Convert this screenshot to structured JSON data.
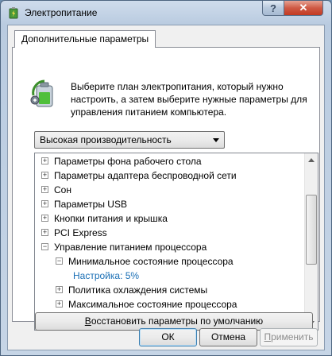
{
  "window": {
    "title": "Электропитание",
    "help_label": "?",
    "close_label": "✕"
  },
  "tab": {
    "label": "Дополнительные параметры"
  },
  "description": "Выберите план электропитания, который нужно настроить, а затем выберите нужные параметры для управления питанием компьютера.",
  "plan_select": {
    "selected": "Высокая производительность"
  },
  "tree": {
    "items": [
      {
        "label": "Параметры фона рабочего стола",
        "expander": "+",
        "level": 0
      },
      {
        "label": "Параметры адаптера беспроводной сети",
        "expander": "+",
        "level": 0
      },
      {
        "label": "Сон",
        "expander": "+",
        "level": 0
      },
      {
        "label": "Параметры USB",
        "expander": "+",
        "level": 0
      },
      {
        "label": "Кнопки питания и крышка",
        "expander": "+",
        "level": 0
      },
      {
        "label": "PCI Express",
        "expander": "+",
        "level": 0
      },
      {
        "label": "Управление питанием процессора",
        "expander": "−",
        "level": 0
      },
      {
        "label": "Минимальное состояние процессора",
        "expander": "−",
        "level": 1
      },
      {
        "label": "Настройка: 5%",
        "expander": "",
        "level": 2,
        "value": true
      },
      {
        "label": "Политика охлаждения системы",
        "expander": "+",
        "level": 1
      },
      {
        "label": "Максимальное состояние процессора",
        "expander": "+",
        "level": 1
      }
    ]
  },
  "buttons": {
    "restore_prefix": "",
    "restore_access": "В",
    "restore_rest": "осстановить параметры по умолчанию",
    "ok": "ОК",
    "cancel": "Отмена",
    "apply_prefix": "",
    "apply_access": "П",
    "apply_rest": "рименить"
  },
  "colors": {
    "setting_value": "#1a6fb5",
    "close_button": "#c23a22"
  }
}
